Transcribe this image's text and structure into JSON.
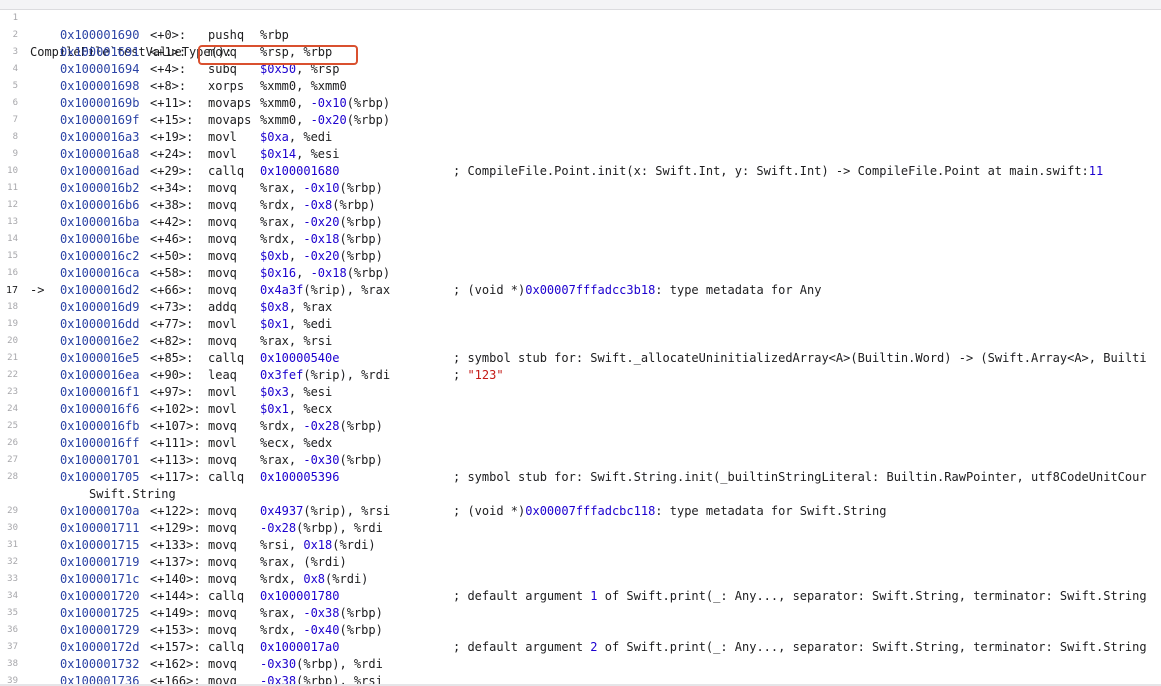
{
  "header": "CompileFile`testValueType():",
  "current_line": "17",
  "current_marker": "->",
  "rows": [
    {
      "ln": "2",
      "addr": "0x100001690",
      "off": "<+0>:",
      "op": "pushq",
      "args": [
        [
          "%rbp",
          "d"
        ]
      ],
      "comment": []
    },
    {
      "ln": "3",
      "addr": "0x100001691",
      "off": "<+1>:",
      "op": "movq",
      "args": [
        [
          "%rsp, %rbp",
          "d"
        ]
      ],
      "comment": []
    },
    {
      "ln": "4",
      "addr": "0x100001694",
      "off": "<+4>:",
      "op": "subq",
      "args": [
        [
          "$0x50",
          "n"
        ],
        [
          ", %rsp",
          "d"
        ]
      ],
      "comment": []
    },
    {
      "ln": "5",
      "addr": "0x100001698",
      "off": "<+8>:",
      "op": "xorps",
      "args": [
        [
          "%xmm0, %xmm0",
          "d"
        ]
      ],
      "comment": []
    },
    {
      "ln": "6",
      "addr": "0x10000169b",
      "off": "<+11>:",
      "op": "movaps",
      "args": [
        [
          "%xmm0, ",
          "d"
        ],
        [
          "-0x10",
          "n"
        ],
        [
          "(%rbp)",
          "d"
        ]
      ],
      "comment": []
    },
    {
      "ln": "7",
      "addr": "0x10000169f",
      "off": "<+15>:",
      "op": "movaps",
      "args": [
        [
          "%xmm0, ",
          "d"
        ],
        [
          "-0x20",
          "n"
        ],
        [
          "(%rbp)",
          "d"
        ]
      ],
      "comment": []
    },
    {
      "ln": "8",
      "addr": "0x1000016a3",
      "off": "<+19>:",
      "op": "movl",
      "args": [
        [
          "$0xa",
          "n"
        ],
        [
          ", %edi",
          "d"
        ]
      ],
      "comment": []
    },
    {
      "ln": "9",
      "addr": "0x1000016a8",
      "off": "<+24>:",
      "op": "movl",
      "args": [
        [
          "$0x14",
          "n"
        ],
        [
          ", %esi",
          "d"
        ]
      ],
      "comment": []
    },
    {
      "ln": "10",
      "addr": "0x1000016ad",
      "off": "<+29>:",
      "op": "callq",
      "args": [
        [
          "0x100001680",
          "n"
        ]
      ],
      "comment": [
        [
          "; CompileFile.Point.init(x: Swift.Int, y: Swift.Int) -> CompileFile.Point at main.swift:",
          "d"
        ],
        [
          "11",
          "n"
        ]
      ]
    },
    {
      "ln": "11",
      "addr": "0x1000016b2",
      "off": "<+34>:",
      "op": "movq",
      "args": [
        [
          "%rax, ",
          "d"
        ],
        [
          "-0x10",
          "n"
        ],
        [
          "(%rbp)",
          "d"
        ]
      ],
      "comment": []
    },
    {
      "ln": "12",
      "addr": "0x1000016b6",
      "off": "<+38>:",
      "op": "movq",
      "args": [
        [
          "%rdx, ",
          "d"
        ],
        [
          "-0x8",
          "n"
        ],
        [
          "(%rbp)",
          "d"
        ]
      ],
      "comment": []
    },
    {
      "ln": "13",
      "addr": "0x1000016ba",
      "off": "<+42>:",
      "op": "movq",
      "args": [
        [
          "%rax, ",
          "d"
        ],
        [
          "-0x20",
          "n"
        ],
        [
          "(%rbp)",
          "d"
        ]
      ],
      "comment": []
    },
    {
      "ln": "14",
      "addr": "0x1000016be",
      "off": "<+46>:",
      "op": "movq",
      "args": [
        [
          "%rdx, ",
          "d"
        ],
        [
          "-0x18",
          "n"
        ],
        [
          "(%rbp)",
          "d"
        ]
      ],
      "comment": []
    },
    {
      "ln": "15",
      "addr": "0x1000016c2",
      "off": "<+50>:",
      "op": "movq",
      "args": [
        [
          "$0xb",
          "n"
        ],
        [
          ", ",
          "d"
        ],
        [
          "-0x20",
          "n"
        ],
        [
          "(%rbp)",
          "d"
        ]
      ],
      "comment": []
    },
    {
      "ln": "16",
      "addr": "0x1000016ca",
      "off": "<+58>:",
      "op": "movq",
      "args": [
        [
          "$0x16",
          "n"
        ],
        [
          ", ",
          "d"
        ],
        [
          "-0x18",
          "n"
        ],
        [
          "(%rbp)",
          "d"
        ]
      ],
      "comment": []
    },
    {
      "ln": "17",
      "addr": "0x1000016d2",
      "off": "<+66>:",
      "op": "movq",
      "args": [
        [
          "0x4a3f",
          "n"
        ],
        [
          "(%rip), %rax",
          "d"
        ]
      ],
      "comment": [
        [
          "; (void *)",
          "d"
        ],
        [
          "0x00007fffadcc3b18",
          "n"
        ],
        [
          ": type metadata for Any",
          "d"
        ]
      ]
    },
    {
      "ln": "18",
      "addr": "0x1000016d9",
      "off": "<+73>:",
      "op": "addq",
      "args": [
        [
          "$0x8",
          "n"
        ],
        [
          ", %rax",
          "d"
        ]
      ],
      "comment": []
    },
    {
      "ln": "19",
      "addr": "0x1000016dd",
      "off": "<+77>:",
      "op": "movl",
      "args": [
        [
          "$0x1",
          "n"
        ],
        [
          ", %edi",
          "d"
        ]
      ],
      "comment": []
    },
    {
      "ln": "20",
      "addr": "0x1000016e2",
      "off": "<+82>:",
      "op": "movq",
      "args": [
        [
          "%rax, %rsi",
          "d"
        ]
      ],
      "comment": []
    },
    {
      "ln": "21",
      "addr": "0x1000016e5",
      "off": "<+85>:",
      "op": "callq",
      "args": [
        [
          "0x10000540e",
          "n"
        ]
      ],
      "comment": [
        [
          "; symbol stub for: Swift._allocateUninitializedArray<A>(Builtin.Word) -> (Swift.Array<A>, Builti",
          "d"
        ]
      ]
    },
    {
      "ln": "22",
      "addr": "0x1000016ea",
      "off": "<+90>:",
      "op": "leaq",
      "args": [
        [
          "0x3fef",
          "n"
        ],
        [
          "(%rip), %rdi",
          "d"
        ]
      ],
      "comment": [
        [
          "; ",
          "d"
        ],
        [
          "\"123\"",
          "s"
        ]
      ]
    },
    {
      "ln": "23",
      "addr": "0x1000016f1",
      "off": "<+97>:",
      "op": "movl",
      "args": [
        [
          "$0x3",
          "n"
        ],
        [
          ", %esi",
          "d"
        ]
      ],
      "comment": []
    },
    {
      "ln": "24",
      "addr": "0x1000016f6",
      "off": "<+102>:",
      "op": "movl",
      "args": [
        [
          "$0x1",
          "n"
        ],
        [
          ", %ecx",
          "d"
        ]
      ],
      "comment": []
    },
    {
      "ln": "25",
      "addr": "0x1000016fb",
      "off": "<+107>:",
      "op": "movq",
      "args": [
        [
          "%rdx, ",
          "d"
        ],
        [
          "-0x28",
          "n"
        ],
        [
          "(%rbp)",
          "d"
        ]
      ],
      "comment": []
    },
    {
      "ln": "26",
      "addr": "0x1000016ff",
      "off": "<+111>:",
      "op": "movl",
      "args": [
        [
          "%ecx, %edx",
          "d"
        ]
      ],
      "comment": []
    },
    {
      "ln": "27",
      "addr": "0x100001701",
      "off": "<+113>:",
      "op": "movq",
      "args": [
        [
          "%rax, ",
          "d"
        ],
        [
          "-0x30",
          "n"
        ],
        [
          "(%rbp)",
          "d"
        ]
      ],
      "comment": []
    },
    {
      "ln": "28",
      "addr": "0x100001705",
      "off": "<+117>:",
      "op": "callq",
      "args": [
        [
          "0x100005396",
          "n"
        ]
      ],
      "comment": [
        [
          "; symbol stub for: Swift.String.init(_builtinStringLiteral: Builtin.RawPointer, utf8CodeUnitCour",
          "d"
        ]
      ]
    },
    {
      "ln": "",
      "cont": "Swift.String"
    },
    {
      "ln": "29",
      "addr": "0x10000170a",
      "off": "<+122>:",
      "op": "movq",
      "args": [
        [
          "0x4937",
          "n"
        ],
        [
          "(%rip), %rsi",
          "d"
        ]
      ],
      "comment": [
        [
          "; (void *)",
          "d"
        ],
        [
          "0x00007fffadcbc118",
          "n"
        ],
        [
          ": type metadata for Swift.String",
          "d"
        ]
      ]
    },
    {
      "ln": "30",
      "addr": "0x100001711",
      "off": "<+129>:",
      "op": "movq",
      "args": [
        [
          "-0x28",
          "n"
        ],
        [
          "(%rbp), %rdi",
          "d"
        ]
      ],
      "comment": []
    },
    {
      "ln": "31",
      "addr": "0x100001715",
      "off": "<+133>:",
      "op": "movq",
      "args": [
        [
          "%rsi, ",
          "d"
        ],
        [
          "0x18",
          "n"
        ],
        [
          "(%rdi)",
          "d"
        ]
      ],
      "comment": []
    },
    {
      "ln": "32",
      "addr": "0x100001719",
      "off": "<+137>:",
      "op": "movq",
      "args": [
        [
          "%rax, (%rdi)",
          "d"
        ]
      ],
      "comment": []
    },
    {
      "ln": "33",
      "addr": "0x10000171c",
      "off": "<+140>:",
      "op": "movq",
      "args": [
        [
          "%rdx, ",
          "d"
        ],
        [
          "0x8",
          "n"
        ],
        [
          "(%rdi)",
          "d"
        ]
      ],
      "comment": []
    },
    {
      "ln": "34",
      "addr": "0x100001720",
      "off": "<+144>:",
      "op": "callq",
      "args": [
        [
          "0x100001780",
          "n"
        ]
      ],
      "comment": [
        [
          "; default argument ",
          "d"
        ],
        [
          "1",
          "n"
        ],
        [
          " of Swift.print(_: Any..., separator: Swift.String, terminator: Swift.String",
          "d"
        ]
      ]
    },
    {
      "ln": "35",
      "addr": "0x100001725",
      "off": "<+149>:",
      "op": "movq",
      "args": [
        [
          "%rax, ",
          "d"
        ],
        [
          "-0x38",
          "n"
        ],
        [
          "(%rbp)",
          "d"
        ]
      ],
      "comment": []
    },
    {
      "ln": "36",
      "addr": "0x100001729",
      "off": "<+153>:",
      "op": "movq",
      "args": [
        [
          "%rdx, ",
          "d"
        ],
        [
          "-0x40",
          "n"
        ],
        [
          "(%rbp)",
          "d"
        ]
      ],
      "comment": []
    },
    {
      "ln": "37",
      "addr": "0x10000172d",
      "off": "<+157>:",
      "op": "callq",
      "args": [
        [
          "0x1000017a0",
          "n"
        ]
      ],
      "comment": [
        [
          "; default argument ",
          "d"
        ],
        [
          "2",
          "n"
        ],
        [
          " of Swift.print(_: Any..., separator: Swift.String, terminator: Swift.String",
          "d"
        ]
      ]
    },
    {
      "ln": "38",
      "addr": "0x100001732",
      "off": "<+162>:",
      "op": "movq",
      "args": [
        [
          "-0x30",
          "n"
        ],
        [
          "(%rbp), %rdi",
          "d"
        ]
      ],
      "comment": []
    },
    {
      "ln": "39",
      "addr": "0x100001736",
      "off": "<+166>:",
      "op": "movq",
      "args": [
        [
          "-0x38",
          "n"
        ],
        [
          "(%rbp), %rsi",
          "d"
        ]
      ],
      "comment": []
    }
  ],
  "colors": {
    "address": "#2b43a5",
    "number": "#1c00cf",
    "string": "#c41a16",
    "highlight": "#d9502f"
  }
}
